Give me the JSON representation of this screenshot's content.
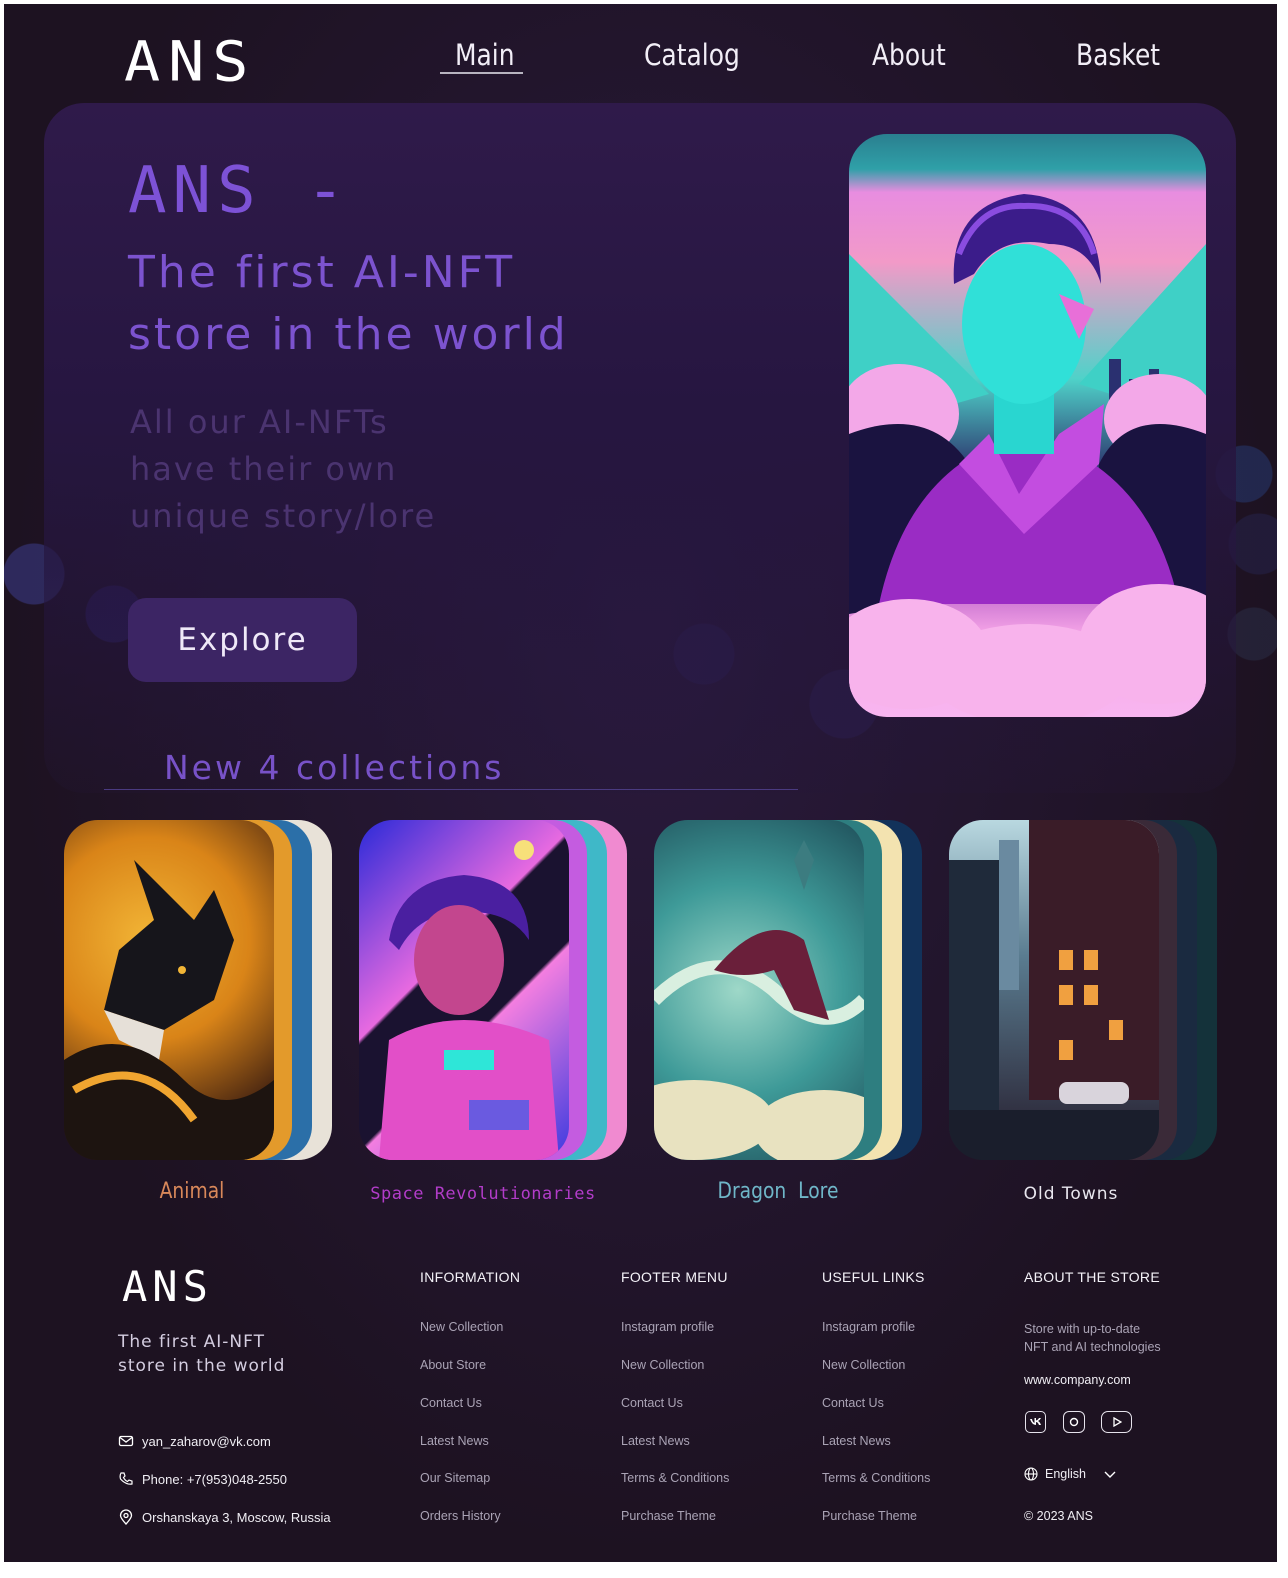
{
  "header": {
    "logo": "ANS",
    "nav": [
      {
        "label": "Main",
        "active": true
      },
      {
        "label": "Catalog",
        "active": false
      },
      {
        "label": "About",
        "active": false
      },
      {
        "label": "Basket",
        "active": false
      }
    ]
  },
  "hero": {
    "title": "ANS -",
    "subtitle_line1": "The first AI-NFT",
    "subtitle_line2": "store in the world",
    "desc_line1": "All our AI-NFTs",
    "desc_line2": "have their own",
    "desc_line3": "unique story/lore",
    "explore_label": "Explore"
  },
  "collections": {
    "title": "New 4 collections",
    "items": [
      {
        "label": "Animal",
        "color": "#d9885a"
      },
      {
        "label": "Space Revolutionaries",
        "color": "#b23cc9"
      },
      {
        "label": "Dragon  Lore",
        "color": "#6fb6c8"
      },
      {
        "label": "Old Towns",
        "color": "#e8e6ee"
      }
    ]
  },
  "footer": {
    "logo": "ANS",
    "tagline_line1": "The first AI-NFT",
    "tagline_line2": "store in the world",
    "email": "yan_zaharov@vk.com",
    "phone": "Phone: +7(953)048-2550",
    "address": "Orshanskaya 3, Moscow, Russia",
    "columns": [
      {
        "title": "INFORMATION",
        "links": [
          "New Collection",
          "About Store",
          "Contact Us",
          "Latest News",
          "Our Sitemap",
          "Orders History"
        ]
      },
      {
        "title": "FOOTER MENU",
        "links": [
          "Instagram profile",
          "New Collection",
          "Contact Us",
          "Latest News",
          "Terms & Conditions",
          "Purchase Theme"
        ]
      },
      {
        "title": "USEFUL LINKS",
        "links": [
          "Instagram profile",
          "New Collection",
          "Contact Us",
          "Latest News",
          "Terms & Conditions",
          "Purchase Theme"
        ]
      }
    ],
    "about": {
      "title": "ABOUT THE STORE",
      "text_line1": "Store with up-to-date",
      "text_line2": "NFT and AI technologies",
      "site": "www.company.com",
      "language": "English",
      "copyright": "© 2023 ANS"
    }
  }
}
